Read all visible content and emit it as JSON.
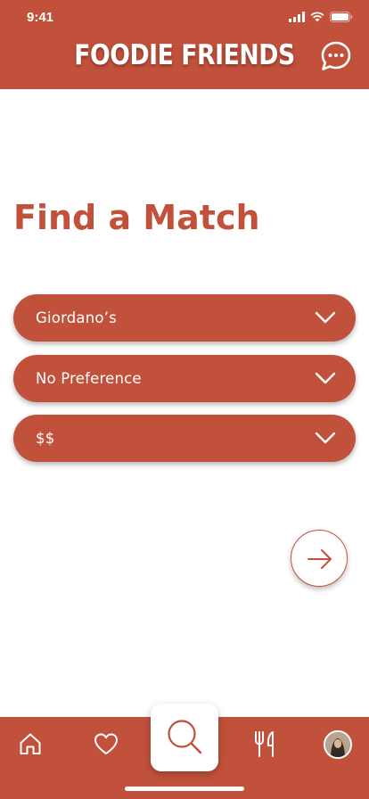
{
  "status_bar": {
    "time": "9:41"
  },
  "header": {
    "title": "FOODIE FRIENDS"
  },
  "page": {
    "title": "Find a Match"
  },
  "selects": [
    {
      "value": "Giordano’s"
    },
    {
      "value": "No Preference"
    },
    {
      "value": "$$"
    }
  ],
  "icons": {
    "chat": "chat-bubble-icon",
    "next": "arrow-right-icon",
    "tabs": [
      "home-icon",
      "heart-icon",
      "search-icon",
      "fork-knife-icon",
      "avatar"
    ]
  },
  "colors": {
    "brand": "#c1513b",
    "background": "#ffffff",
    "text_on_brand": "#ffffff"
  }
}
